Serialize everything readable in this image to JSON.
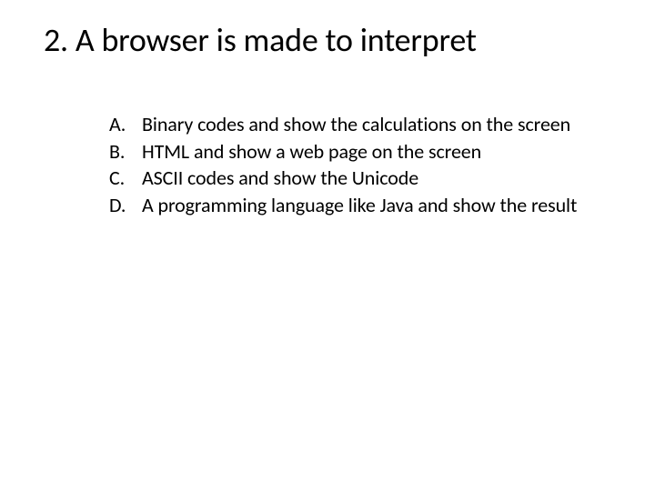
{
  "title": "2. A browser is made to interpret",
  "options": [
    {
      "marker": "A.",
      "text": "Binary codes and show the calculations on the screen"
    },
    {
      "marker": "B.",
      "text": "HTML and show a web page on the screen"
    },
    {
      "marker": "C.",
      "text": "ASCII codes and show the Unicode"
    },
    {
      "marker": "D.",
      "text": "A programming language like Java and show the result"
    }
  ]
}
